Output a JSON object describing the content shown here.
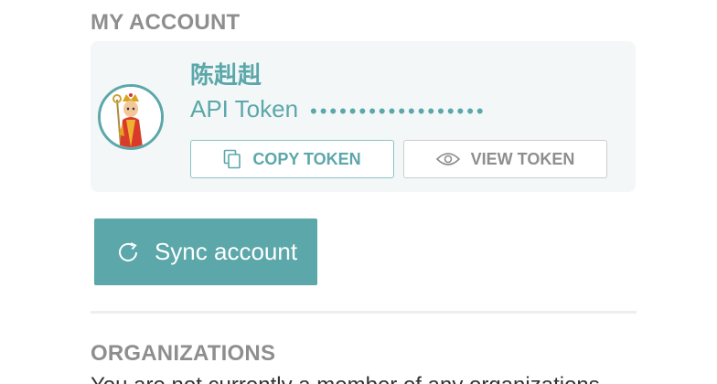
{
  "account": {
    "section_title": "MY ACCOUNT",
    "avatar_icon": "monk-avatar-icon",
    "user_name": "陈赳赳",
    "token_label": "API Token",
    "token_mask": "••••••••••••••••••",
    "copy_token_label": "COPY TOKEN",
    "copy_icon": "copy-icon",
    "view_token_label": "VIEW TOKEN",
    "view_icon": "eye-icon",
    "sync_label": "Sync account",
    "sync_icon": "refresh-icon"
  },
  "organizations": {
    "section_title": "ORGANIZATIONS",
    "description": "You are not currently a member of any organizations."
  },
  "colors": {
    "accent": "#5ba7aa",
    "card_bg": "#f3f7f7",
    "heading_gray": "#8e8e8e"
  }
}
